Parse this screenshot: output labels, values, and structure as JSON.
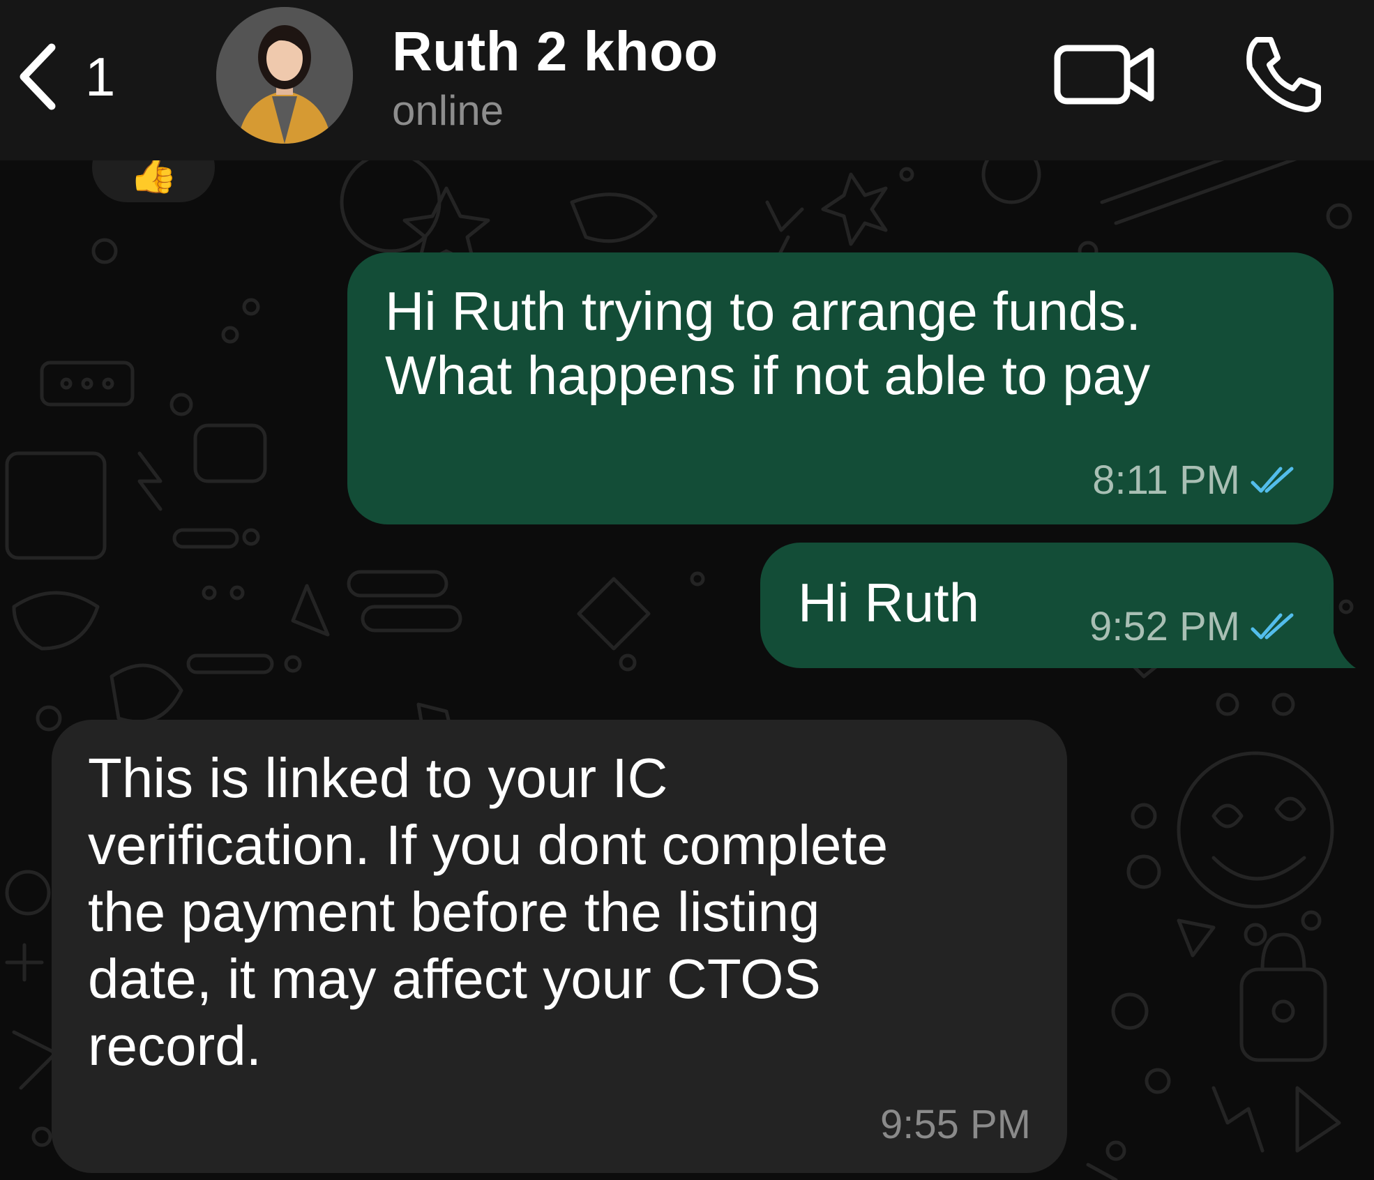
{
  "header": {
    "back_count": "1",
    "contact_name": "Ruth 2 khoo",
    "contact_status": "online",
    "icons": {
      "back": "chevron-left-icon",
      "video": "video-camera-icon",
      "call": "phone-icon"
    }
  },
  "reaction": {
    "emoji": "👍"
  },
  "messages": [
    {
      "direction": "outgoing",
      "text": "Hi Ruth trying to arrange funds.\nWhat happens if not able to pay",
      "time": "8:11 PM",
      "status": "read"
    },
    {
      "direction": "outgoing",
      "text": "Hi Ruth",
      "time": "9:52 PM",
      "status": "read"
    },
    {
      "direction": "incoming",
      "text": "This is linked to your IC\nverification. If you dont complete\nthe payment before the listing\ndate, it may affect your CTOS\nrecord.",
      "time": "9:55 PM"
    }
  ],
  "colors": {
    "header_bg": "#161616",
    "chat_bg": "#0c0c0c",
    "outgoing_bubble": "#134d37",
    "incoming_bubble": "#232323",
    "read_tick": "#53bdeb"
  }
}
